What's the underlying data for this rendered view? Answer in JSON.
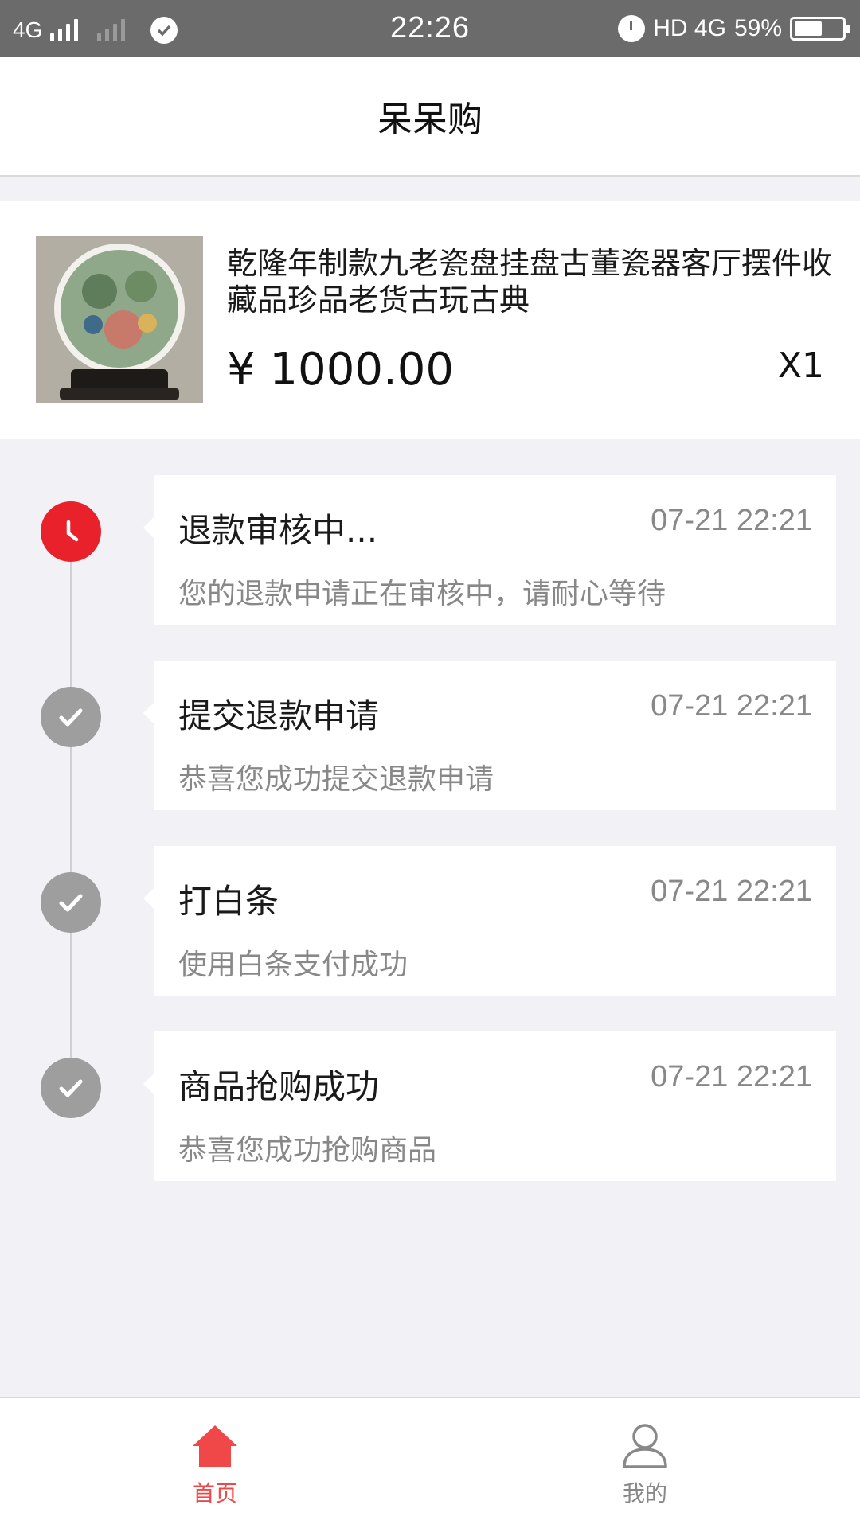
{
  "status_bar": {
    "network": "4G",
    "time": "22:26",
    "right_text": "HD 4G",
    "battery": "59%",
    "battery_level": 0.59
  },
  "header": {
    "title": "呆呆购"
  },
  "product": {
    "name": "乾隆年制款九老瓷盘挂盘古董瓷器客厅摆件收藏品珍品老货古玩古典",
    "price": "¥ 1000.00",
    "quantity": "X1"
  },
  "timeline": [
    {
      "title": "退款审核中...",
      "time": "07-21 22:21",
      "desc": "您的退款申请正在审核中，请耐心等待",
      "icon": "clock-icon",
      "color": "#e8212b"
    },
    {
      "title": "提交退款申请",
      "time": "07-21 22:21",
      "desc": "恭喜您成功提交退款申请",
      "icon": "check-icon",
      "color": "#9e9e9e"
    },
    {
      "title": "打白条",
      "time": "07-21 22:21",
      "desc": "使用白条支付成功",
      "icon": "check-icon",
      "color": "#9e9e9e"
    },
    {
      "title": "商品抢购成功",
      "time": "07-21 22:21",
      "desc": "恭喜您成功抢购商品",
      "icon": "check-icon",
      "color": "#9e9e9e"
    }
  ],
  "tabbar": {
    "home": {
      "label": "首页",
      "icon": "home-icon",
      "active": true,
      "color": "#f04848"
    },
    "mine": {
      "label": "我的",
      "icon": "user-icon",
      "active": false,
      "color": "#888888"
    }
  }
}
